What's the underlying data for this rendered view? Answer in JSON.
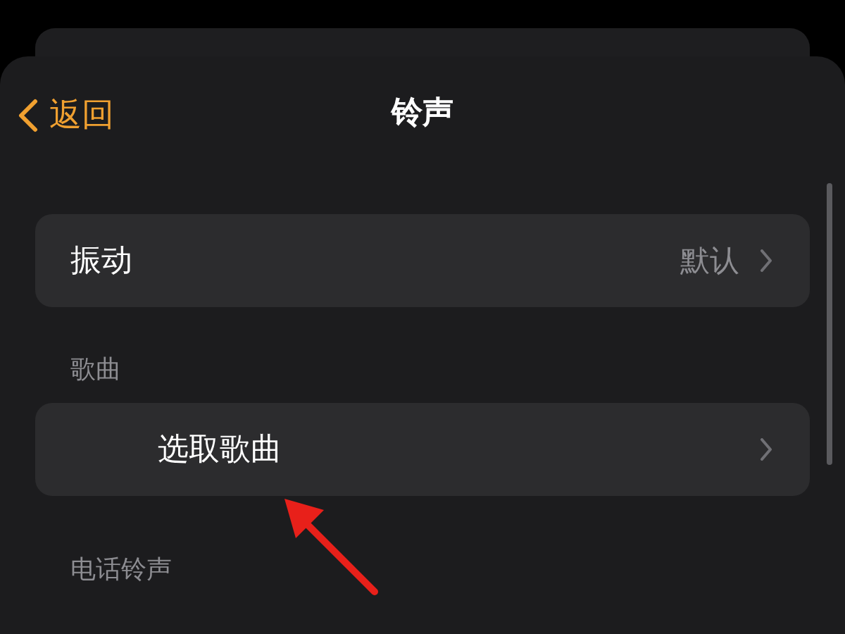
{
  "nav": {
    "back": "返回",
    "title": "铃声"
  },
  "sections": [
    {
      "rows": [
        {
          "kind": "value",
          "label": "振动",
          "value": "默认"
        }
      ]
    },
    {
      "header": "歌曲",
      "rows": [
        {
          "kind": "picker",
          "label": "选取歌曲"
        }
      ]
    },
    {
      "header": "电话铃声"
    }
  ],
  "annotation_arrow": true
}
